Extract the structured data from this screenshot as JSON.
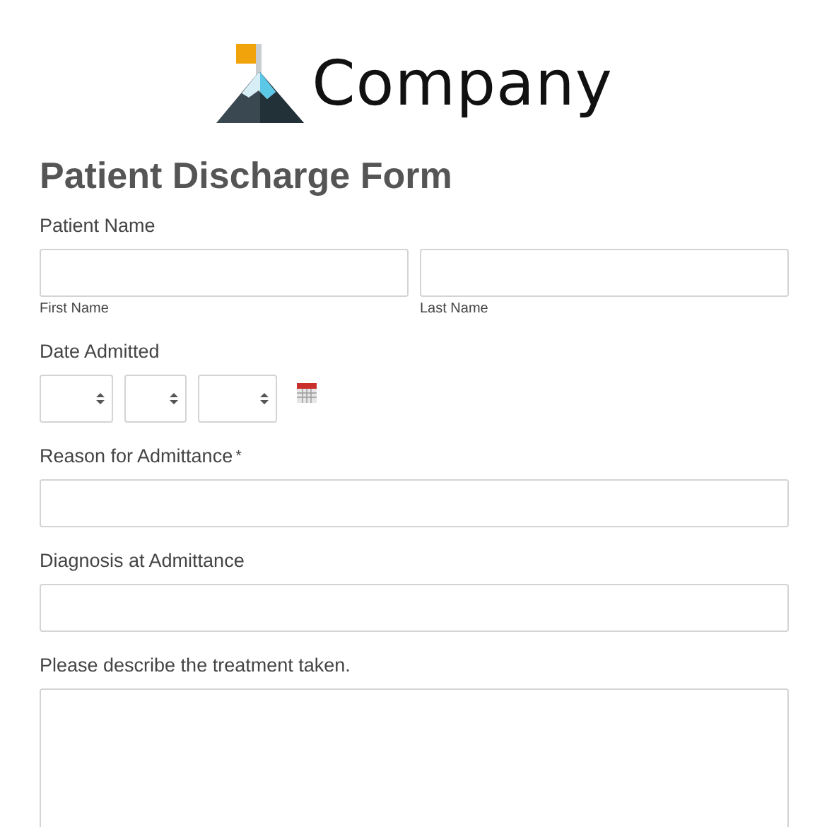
{
  "logo": {
    "name": "Company"
  },
  "form": {
    "title": "Patient Discharge Form",
    "fields": [
      {
        "kind": "name_pair",
        "label": "Patient Name",
        "sublabels": [
          "First Name",
          "Last Name"
        ]
      },
      {
        "kind": "date",
        "label": "Date Admitted"
      },
      {
        "kind": "text",
        "label": "Reason for Admittance",
        "required_mark": "*"
      },
      {
        "kind": "text",
        "label": "Diagnosis at Admittance"
      },
      {
        "kind": "textarea",
        "label": "Please describe the treatment taken."
      }
    ]
  }
}
